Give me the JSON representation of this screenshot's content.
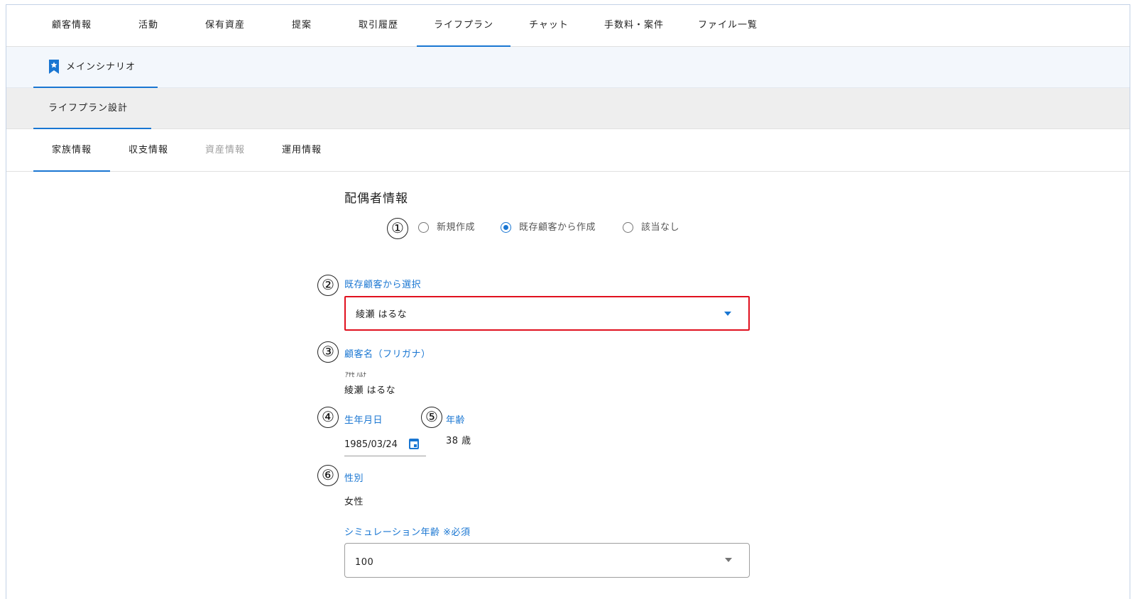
{
  "top_tabs": [
    {
      "label": "顧客情報"
    },
    {
      "label": "活動"
    },
    {
      "label": "保有資産"
    },
    {
      "label": "提案"
    },
    {
      "label": "取引履歴"
    },
    {
      "label": "ライフプラン",
      "active": true
    },
    {
      "label": "チャット"
    },
    {
      "label": "手数料・案件"
    },
    {
      "label": "ファイル一覧"
    }
  ],
  "scenario": {
    "label": "メインシナリオ",
    "icon": "bookmark-star-icon"
  },
  "design_tab": {
    "label": "ライフプラン設計"
  },
  "sub_tabs": [
    {
      "label": "家族情報",
      "active": true
    },
    {
      "label": "収支情報"
    },
    {
      "label": "資産情報",
      "disabled": true
    },
    {
      "label": "運用情報"
    }
  ],
  "section": {
    "title": "配偶者情報",
    "markers": [
      "①",
      "②",
      "③",
      "④",
      "⑤",
      "⑥"
    ],
    "creation_options": [
      {
        "label": "新規作成",
        "checked": false
      },
      {
        "label": "既存顧客から作成",
        "checked": true
      },
      {
        "label": "該当なし",
        "checked": false
      }
    ],
    "existing_customer": {
      "label": "既存顧客から選択",
      "value": "綾瀬 はるな"
    },
    "customer_name": {
      "label": "顧客名（フリガナ）",
      "furigana": "ｱﾔｾ ﾊﾙﾅ",
      "value": "綾瀬 はるな"
    },
    "birthdate": {
      "label": "生年月日",
      "value": "1985/03/24"
    },
    "age": {
      "label": "年齢",
      "value": "38 歳"
    },
    "gender": {
      "label": "性別",
      "value": "女性"
    },
    "simulation_age": {
      "label": "シミュレーション年齢 ※必須",
      "value": "100"
    }
  },
  "colors": {
    "accent": "#1976d2",
    "highlight_border": "#e0101e",
    "scenario_bg": "#f3f7fc",
    "design_bg": "#eeeeee"
  }
}
